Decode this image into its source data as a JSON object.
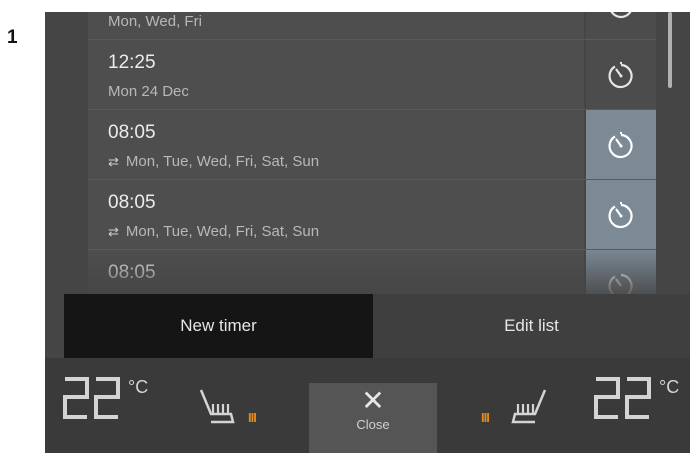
{
  "step_number": "1",
  "timers": [
    {
      "time": "",
      "days": "Mon, Wed, Fri",
      "repeat": false,
      "active": false
    },
    {
      "time": "12:25",
      "days": "Mon 24 Dec",
      "repeat": false,
      "active": false
    },
    {
      "time": "08:05",
      "days": "Mon, Tue, Wed, Fri, Sat, Sun",
      "repeat": true,
      "active": true
    },
    {
      "time": "08:05",
      "days": "Mon, Tue, Wed, Fri, Sat, Sun",
      "repeat": true,
      "active": true
    },
    {
      "time": "08:05",
      "days": "",
      "repeat": false,
      "active": true
    }
  ],
  "tabs": {
    "new_timer": "New timer",
    "edit_list": "Edit list"
  },
  "climate": {
    "left_temp": "22",
    "right_temp": "22",
    "unit": "°C",
    "left_seat_level": "III",
    "right_seat_level": "III",
    "close_label": "Close",
    "close_icon": "close-icon"
  },
  "colors": {
    "active_button": "#7c8a96",
    "seat_heat_level": "#e08a1a"
  }
}
